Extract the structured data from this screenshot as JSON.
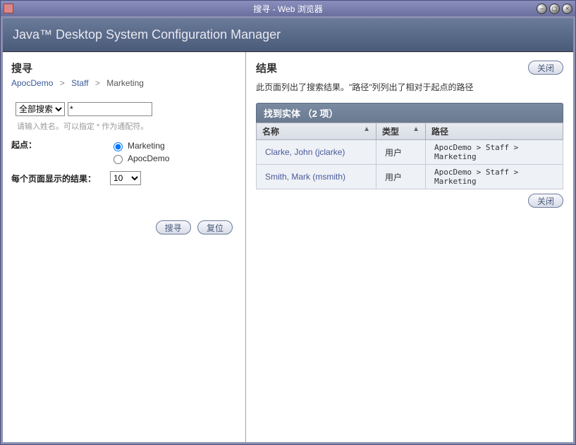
{
  "window": {
    "title": "搜寻 - Web 浏览器"
  },
  "banner": "Java™ Desktop System Configuration Manager",
  "search": {
    "heading": "搜寻",
    "breadcrumb": [
      "ApocDemo",
      "Staff",
      "Marketing"
    ],
    "scope_options": [
      "全部搜索"
    ],
    "scope_selected": "全部搜索",
    "query": "*",
    "hint": "请输入姓名。可以指定 * 作为通配符。",
    "start_label": "起点：",
    "start_options": [
      "Marketing",
      "ApocDemo"
    ],
    "start_selected": "Marketing",
    "perpage_label": "每个页面显示的结果：",
    "perpage_options": [
      "10"
    ],
    "perpage_selected": "10",
    "btn_search": "搜寻",
    "btn_reset": "复位"
  },
  "results": {
    "heading": "结果",
    "desc": "此页面列出了搜索结果。\"路径\"列列出了相对于起点的路径",
    "btn_close": "关闭",
    "panel_title": "找到实体 （2 项）",
    "columns": {
      "name": "名称",
      "type": "类型",
      "path": "路径"
    },
    "rows": [
      {
        "name": "Clarke, John (jclarke)",
        "type": "用户",
        "path": "ApocDemo > Staff > Marketing"
      },
      {
        "name": "Smith, Mark (msmith)",
        "type": "用户",
        "path": "ApocDemo > Staff > Marketing"
      }
    ]
  }
}
